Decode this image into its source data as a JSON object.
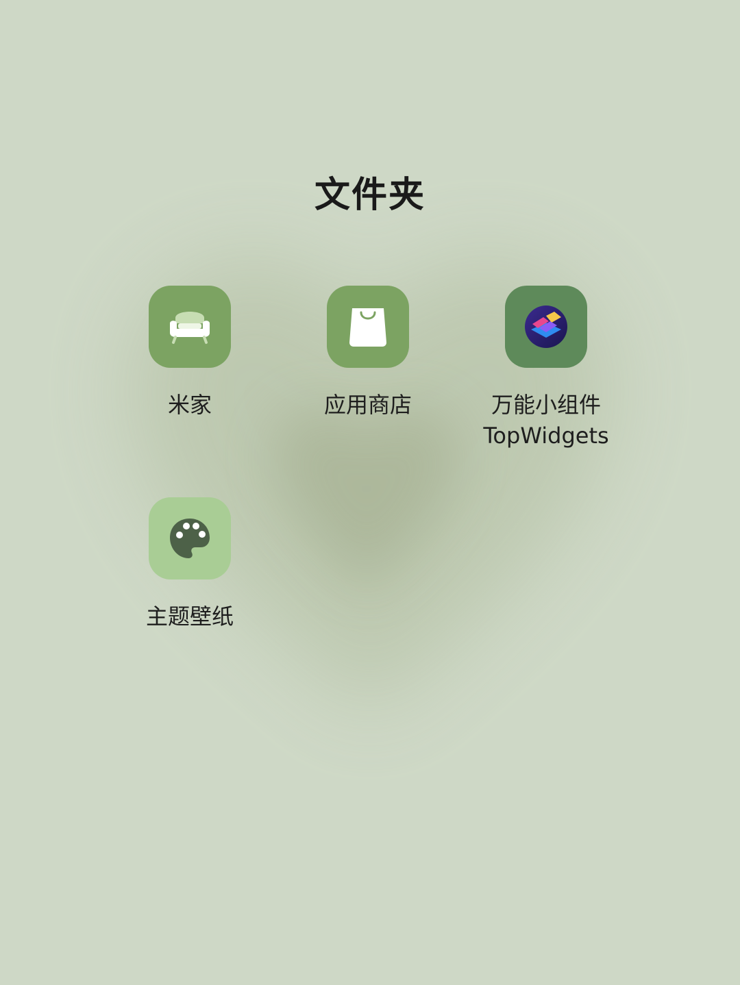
{
  "folder": {
    "title": "文件夹"
  },
  "apps": [
    {
      "label": "米家",
      "icon": "sofa-icon",
      "color": "#7ca362"
    },
    {
      "label": "应用商店",
      "icon": "shopping-bag-icon",
      "color": "#7ca362"
    },
    {
      "label_line1": "万能小组件",
      "label_line2": "TopWidgets",
      "icon": "layers-icon",
      "color": "#5e8a5a"
    },
    {
      "label": "主题壁纸",
      "icon": "palette-icon",
      "color": "#a9cd95"
    }
  ],
  "colors": {
    "background": "#ced8c6",
    "heart_shadow": "#b0bca2",
    "text": "#1e1e1e"
  }
}
